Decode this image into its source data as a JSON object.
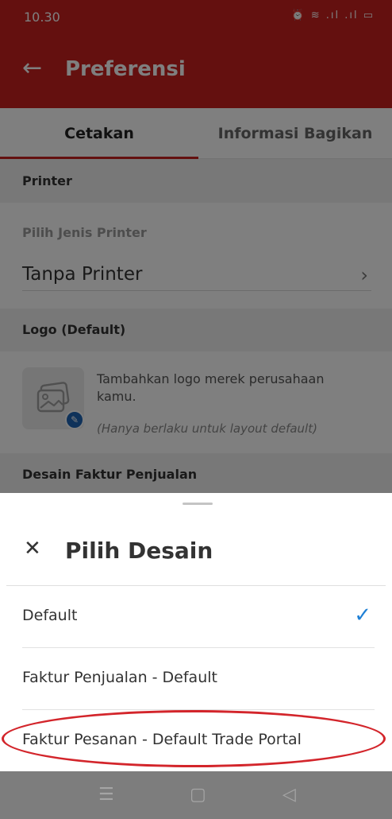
{
  "status_bar": {
    "time": "10.30",
    "icons": "⏰ ≋ .ıl .ıl ▭"
  },
  "app_bar": {
    "title": "Preferensi",
    "back_glyph": "←"
  },
  "tabs": [
    {
      "label": "Cetakan"
    },
    {
      "label": "Informasi Bagikan"
    }
  ],
  "printer_section": {
    "header": "Printer",
    "field_label": "Pilih Jenis Printer",
    "value": "Tanpa Printer",
    "chevron_glyph": "›"
  },
  "logo_section": {
    "header": "Logo (Default)",
    "description": "Tambahkan logo merek perusahaan kamu.",
    "note": "(Hanya berlaku untuk layout default)",
    "edit_glyph": "✎"
  },
  "desain_section": {
    "header": "Desain Faktur Penjualan"
  },
  "sheet": {
    "close_glyph": "✕",
    "title": "Pilih Desain",
    "check_glyph": "✓",
    "options": [
      {
        "label": "Default",
        "selected": true
      },
      {
        "label": "Faktur Penjualan - Default",
        "selected": false
      },
      {
        "label": "Faktur Pesanan - Default Trade Portal",
        "selected": false
      }
    ]
  },
  "nav": {
    "menu_glyph": "☰",
    "home_glyph": "▢",
    "back_glyph": "◁"
  },
  "colors": {
    "brand": "#c8201f",
    "accent": "#1f80d6",
    "highlight": "#d3252b"
  }
}
